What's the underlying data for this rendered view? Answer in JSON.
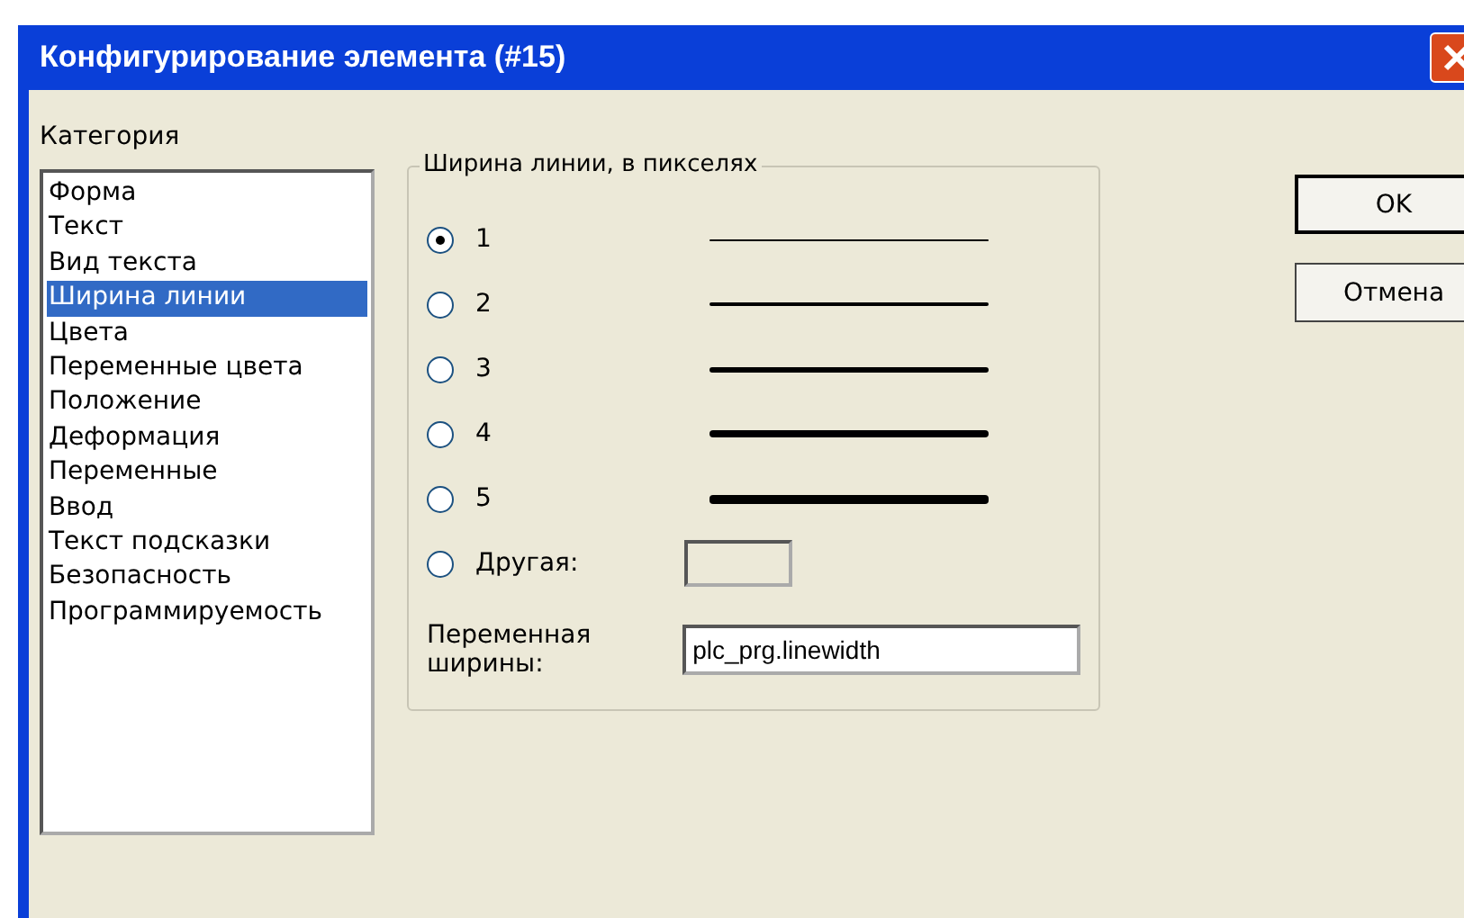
{
  "window": {
    "title": "Конфигурирование элемента (#15)"
  },
  "category": {
    "label": "Категория",
    "items": [
      {
        "label": "Форма",
        "selected": false
      },
      {
        "label": "Текст",
        "selected": false
      },
      {
        "label": "Вид текста",
        "selected": false
      },
      {
        "label": "Ширина линии",
        "selected": true
      },
      {
        "label": "Цвета",
        "selected": false
      },
      {
        "label": "Переменные цвета",
        "selected": false
      },
      {
        "label": "Положение",
        "selected": false
      },
      {
        "label": "Деформация",
        "selected": false
      },
      {
        "label": "Переменные",
        "selected": false
      },
      {
        "label": "Ввод",
        "selected": false
      },
      {
        "label": "Текст подсказки",
        "selected": false
      },
      {
        "label": "Безопасность",
        "selected": false
      },
      {
        "label": "Программируемость",
        "selected": false
      }
    ]
  },
  "line_width": {
    "title": "Ширина линии, в пикселях",
    "options": [
      {
        "kind": "preset",
        "label": "1",
        "selected": true
      },
      {
        "kind": "preset",
        "label": "2",
        "selected": false
      },
      {
        "kind": "preset",
        "label": "3",
        "selected": false
      },
      {
        "kind": "preset",
        "label": "4",
        "selected": false
      },
      {
        "kind": "preset",
        "label": "5",
        "selected": false
      },
      {
        "kind": "other",
        "label": "Другая:",
        "selected": false
      }
    ],
    "variable_label": "Переменная ширины:",
    "variable_value": "plc_prg.linewidth"
  },
  "buttons": [
    "OK",
    "Отмена"
  ]
}
